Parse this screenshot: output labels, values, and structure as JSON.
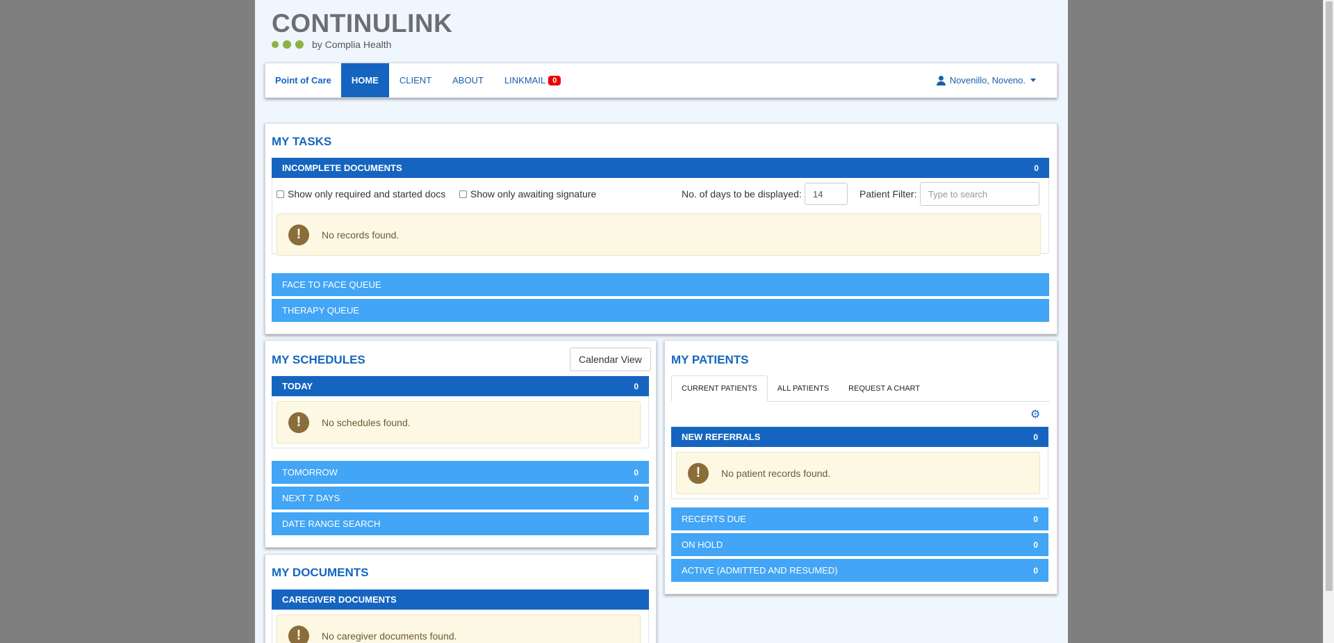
{
  "logo": {
    "brand": "CONTINULINK",
    "by": "by Complia Health"
  },
  "nav": {
    "brand": "Point of Care",
    "items": [
      "HOME",
      "CLIENT",
      "ABOUT",
      "LINKMAIL"
    ],
    "linkmail_badge": "0",
    "user": "Novenillo, Noveno."
  },
  "tasks": {
    "title": "MY TASKS",
    "incomplete": {
      "label": "INCOMPLETE DOCUMENTS",
      "count": "0"
    },
    "check_required": "Show only required and started docs",
    "check_awaiting": "Show only awaiting signature",
    "days_label": "No. of days to be displayed:",
    "days_value": "14",
    "filter_label": "Patient Filter:",
    "filter_placeholder": "Type to search",
    "empty": "No records found.",
    "face_queue": "FACE TO FACE QUEUE",
    "therapy_queue": "THERAPY QUEUE"
  },
  "schedules": {
    "title": "MY SCHEDULES",
    "calendar_button": "Calendar View",
    "today": {
      "label": "TODAY",
      "count": "0"
    },
    "empty": "No schedules found.",
    "tomorrow": {
      "label": "TOMORROW",
      "count": "0"
    },
    "next7": {
      "label": "NEXT 7 DAYS",
      "count": "0"
    },
    "date_range": "DATE RANGE SEARCH"
  },
  "documents": {
    "title": "MY DOCUMENTS",
    "caregiver": "CAREGIVER DOCUMENTS",
    "empty": "No caregiver documents found."
  },
  "patients": {
    "title": "MY PATIENTS",
    "tabs": [
      "CURRENT PATIENTS",
      "ALL PATIENTS",
      "REQUEST A CHART"
    ],
    "new_referrals": {
      "label": "NEW REFERRALS",
      "count": "0"
    },
    "empty": "No patient records found.",
    "recerts": {
      "label": "RECERTS DUE",
      "count": "0"
    },
    "on_hold": {
      "label": "ON HOLD",
      "count": "0"
    },
    "active": {
      "label": "ACTIVE (ADMITTED AND RESUMED)",
      "count": "0"
    }
  },
  "icons": {
    "alert": "exclamation-icon",
    "settings": "gear-icon",
    "user": "user-icon"
  },
  "colors": {
    "primary": "#1565c0",
    "secondary": "#42a5f5",
    "alert_bg": "#fcf8e3",
    "badge": "#ee0000"
  }
}
